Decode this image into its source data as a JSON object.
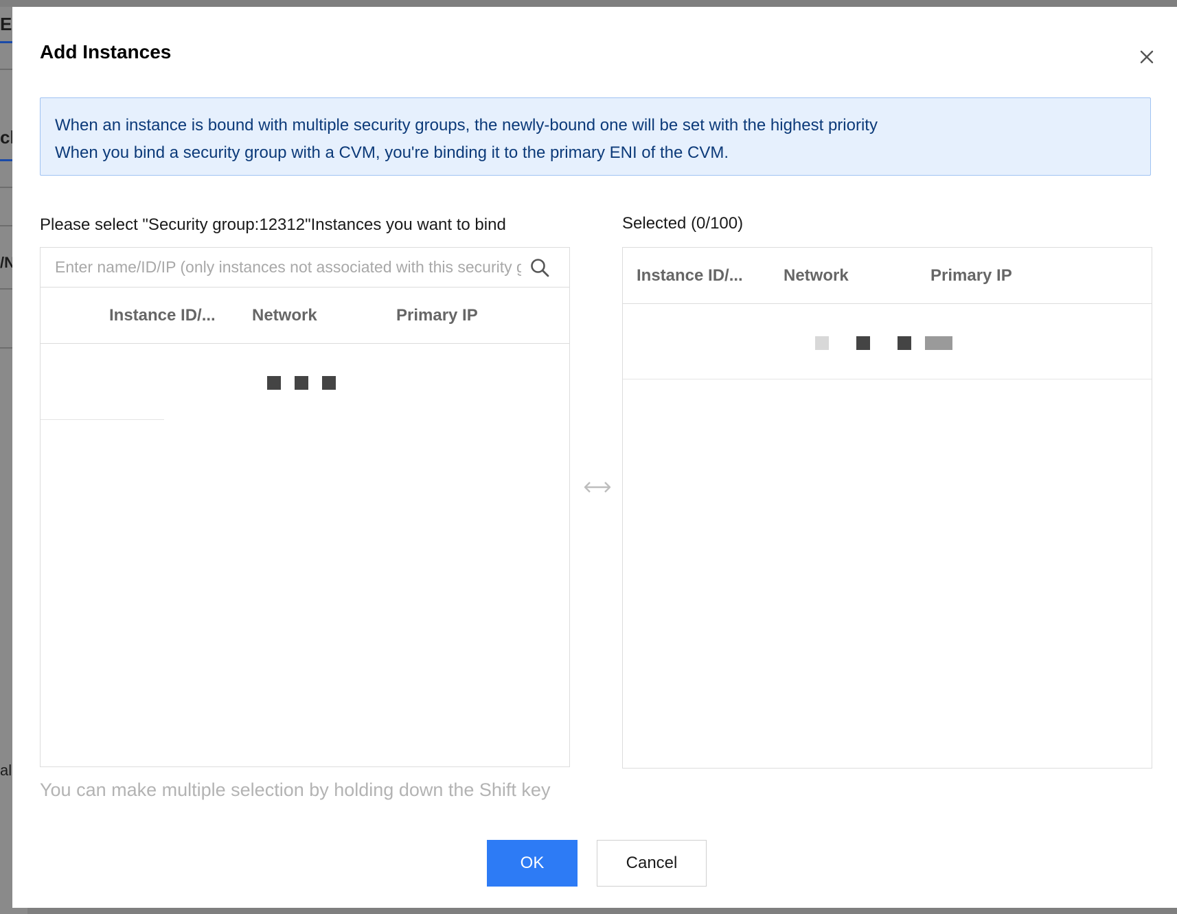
{
  "background_page": {
    "fragments": [
      "E",
      "ch",
      "/N",
      "al"
    ]
  },
  "dialog": {
    "title": "Add Instances",
    "close_icon": "close-icon",
    "notice": {
      "line1": "When an instance is bound with multiple security groups, the newly-bound one will be set with the highest priority",
      "line2": "When you bind a security group with a CVM, you're binding it to the primary ENI of the CVM."
    },
    "source": {
      "label": "Please select \"Security group:12312\"Instances you want to bind",
      "search": {
        "value": "",
        "placeholder": "Enter name/ID/IP (only instances not associated with this security group)",
        "icon": "search-icon"
      },
      "columns": [
        "Instance ID/...",
        "Network",
        "Primary IP"
      ],
      "loading_icon": "loading-dots-icon"
    },
    "transfer_icon": "double-arrow-icon",
    "target": {
      "label": "Selected (0/100)",
      "columns": [
        "Instance ID/...",
        "Network",
        "Primary IP"
      ],
      "loading_icon": "loading-dots-icon"
    },
    "hint": "You can make multiple selection by holding down the Shift key",
    "ok_label": "OK",
    "cancel_label": "Cancel"
  },
  "colors": {
    "primary": "#2d7bf5",
    "notice_bg": "#e6f0fd",
    "notice_border": "#9fc2f2",
    "notice_text": "#0c3a79",
    "loading_dot": "#444444"
  }
}
